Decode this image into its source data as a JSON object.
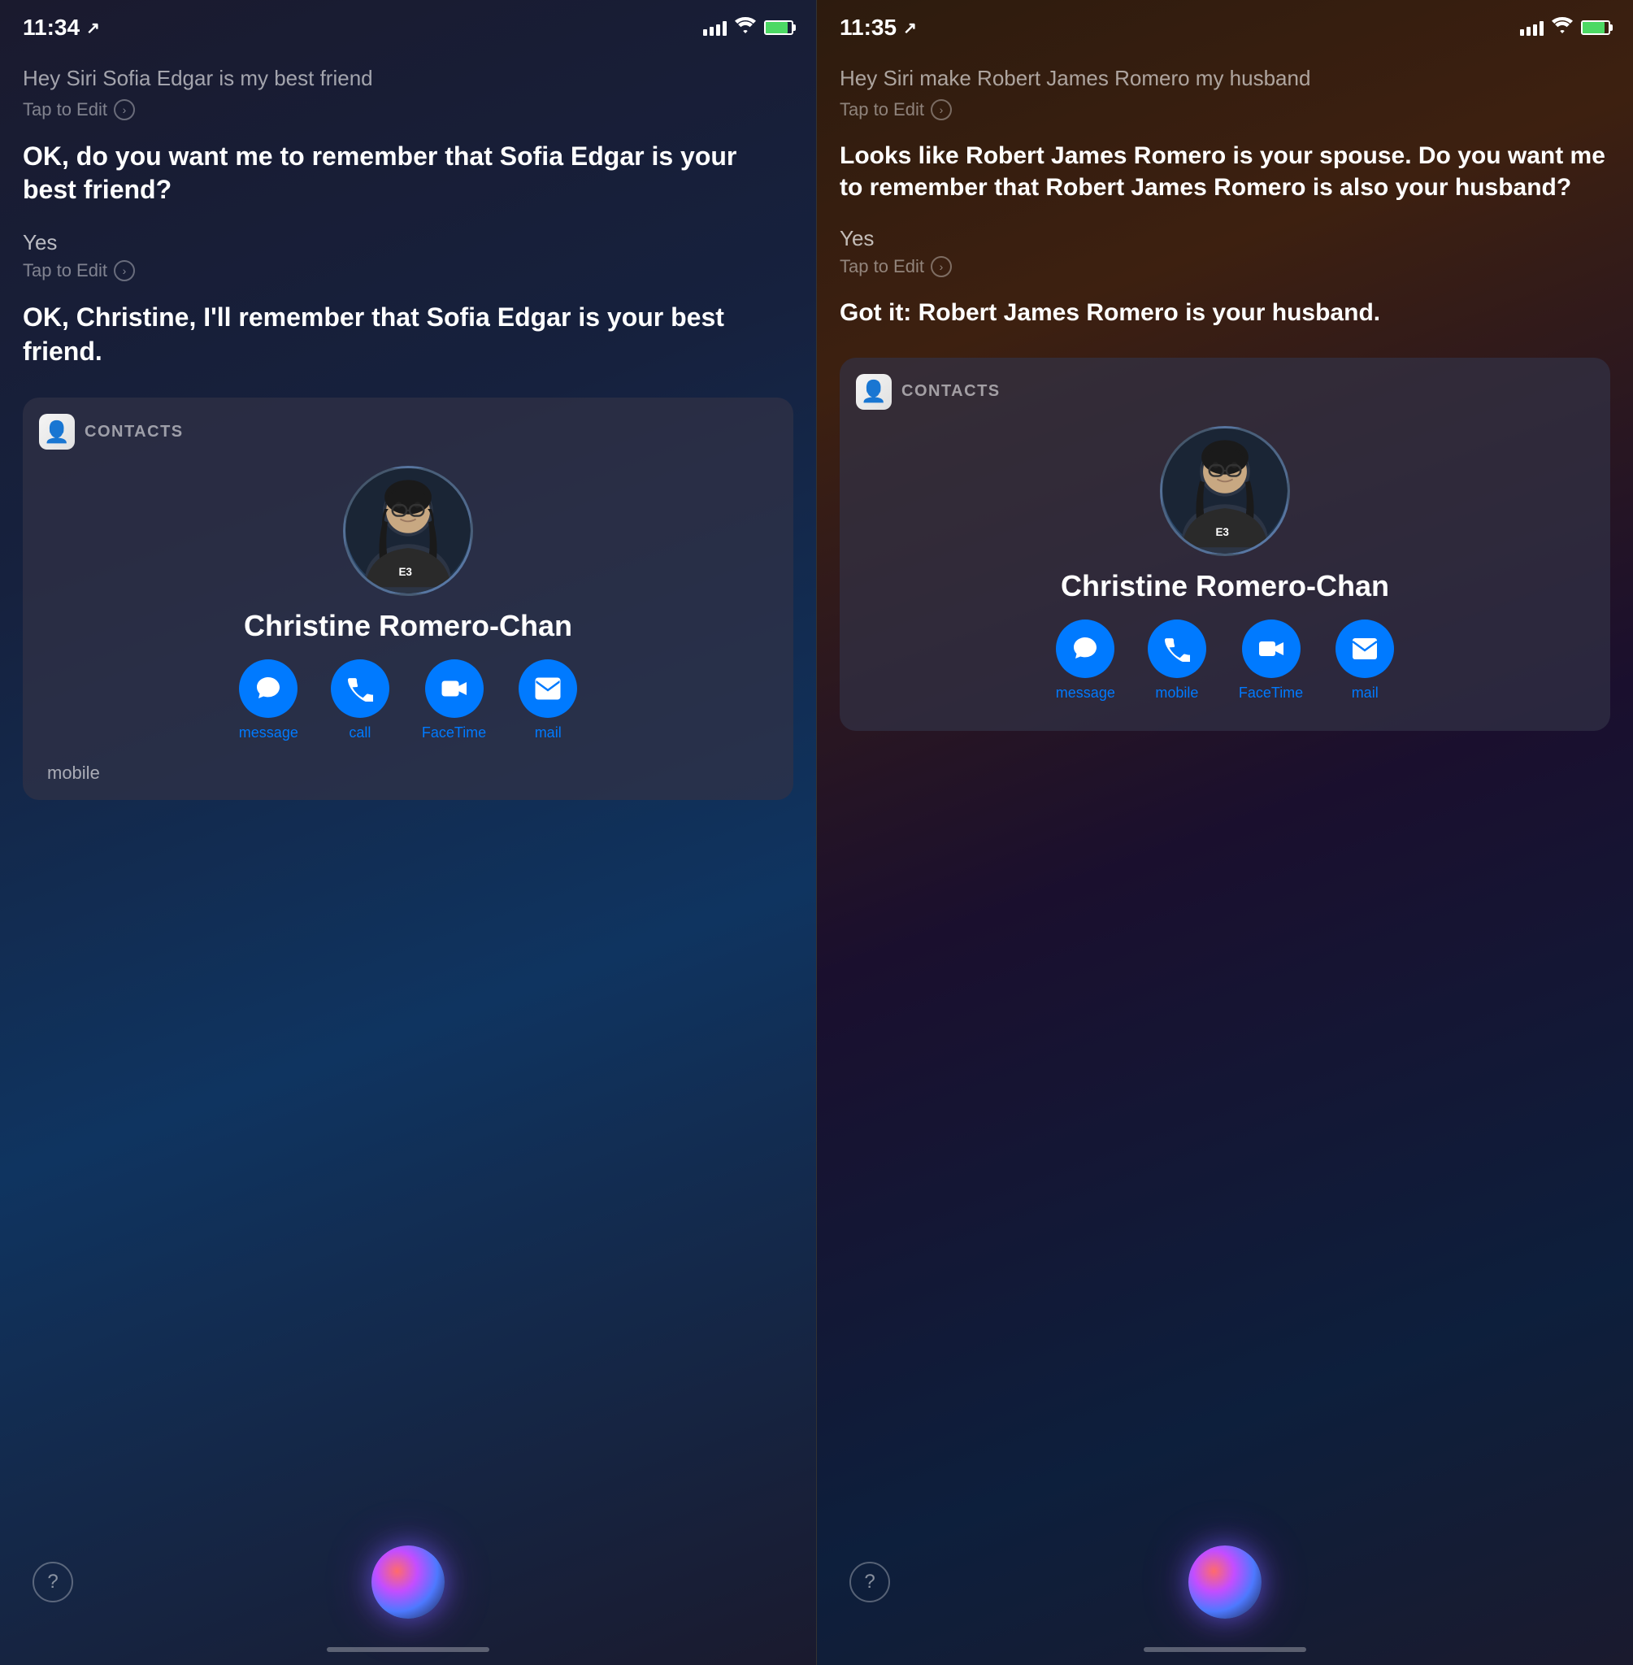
{
  "left": {
    "status": {
      "time": "11:34",
      "location": "↗"
    },
    "query": "Hey Siri Sofia Edgar is my best friend",
    "tap_to_edit_1": "Tap to Edit",
    "siri_response_1": "OK, do you want me to remember that Sofia Edgar is your best friend?",
    "user_reply": "Yes",
    "tap_to_edit_2": "Tap to Edit",
    "siri_response_2": "OK, Christine, I'll remember that Sofia Edgar is your best friend.",
    "contacts_label": "CONTACTS",
    "contact_name": "Christine Romero-Chan",
    "actions": [
      {
        "label": "message",
        "icon": "💬"
      },
      {
        "label": "call",
        "icon": "📞"
      },
      {
        "label": "FaceTime",
        "icon": "📹"
      },
      {
        "label": "mail",
        "icon": "✉"
      }
    ],
    "mobile_label": "mobile",
    "question_mark": "?",
    "bottom_spacer": ""
  },
  "right": {
    "status": {
      "time": "11:35",
      "location": "↗"
    },
    "query": "Hey Siri make Robert James Romero my husband",
    "tap_to_edit_1": "Tap to Edit",
    "siri_response_1": "Looks like Robert James Romero is your spouse. Do you want me to remember that Robert James Romero is also your husband?",
    "user_reply": "Yes",
    "tap_to_edit_2": "Tap to Edit",
    "siri_response_2": "Got it: Robert James Romero is your husband.",
    "contacts_label": "CONTACTS",
    "contact_name": "Christine Romero-Chan",
    "actions": [
      {
        "label": "message",
        "icon": "💬"
      },
      {
        "label": "mobile",
        "icon": "📞"
      },
      {
        "label": "FaceTime",
        "icon": "📹"
      },
      {
        "label": "mail",
        "icon": "✉"
      }
    ],
    "question_mark": "?"
  }
}
